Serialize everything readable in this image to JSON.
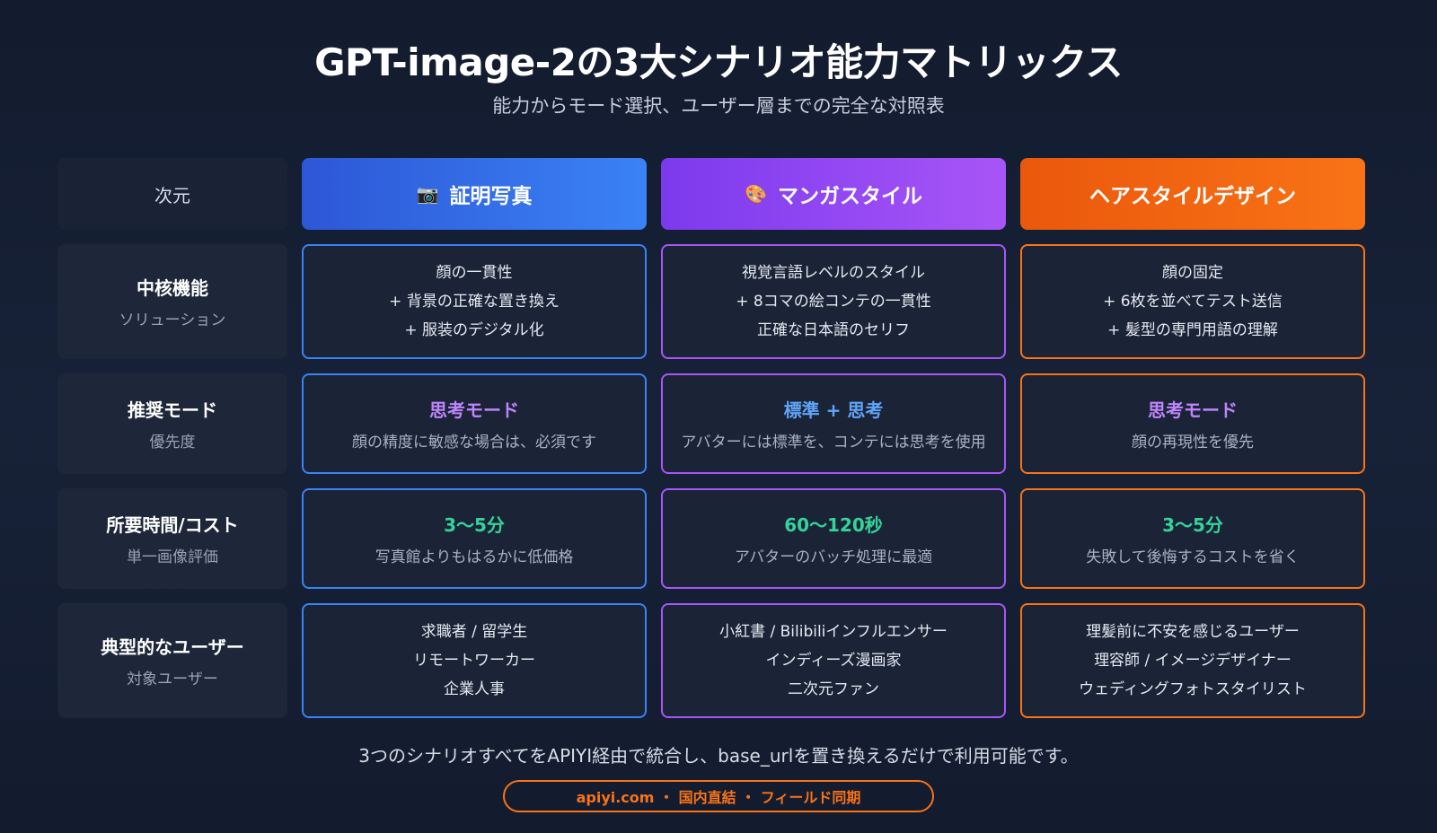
{
  "title": "GPT-image-2の3大シナリオ能力マトリックス",
  "subtitle": "能力からモード選択、ユーザー層までの完全な対照表",
  "matrix": {
    "dimension_header": "次元",
    "columns": [
      {
        "icon": "📷",
        "icon_name": "camera-icon",
        "label": "証明写真",
        "color": "#3b82f6"
      },
      {
        "icon": "🎨",
        "icon_name": "palette-icon",
        "label": "マンガスタイル",
        "color": "#a855f7"
      },
      {
        "icon": "",
        "icon_name": "",
        "label": "ヘアスタイルデザイン",
        "color": "#f97316"
      }
    ],
    "rows": [
      {
        "label": "中核機能",
        "sublabel": "ソリューション",
        "cells": [
          {
            "lines": [
              "顔の一貫性",
              "+ 背景の正確な置き換え",
              "+ 服装のデジタル化"
            ]
          },
          {
            "lines": [
              "視覚言語レベルのスタイル",
              "+ 8コマの絵コンテの一貫性",
              "正確な日本語のセリフ"
            ]
          },
          {
            "lines": [
              "顔の固定",
              "+ 6枚を並べてテスト送信",
              "+ 髪型の専門用語の理解"
            ]
          }
        ]
      },
      {
        "label": "推奨モード",
        "sublabel": "優先度",
        "cells": [
          {
            "accent": "思考モード",
            "accent_color": "#c084fc",
            "desc": "顔の精度に敏感な場合は、必須です"
          },
          {
            "accent": "標準 + 思考",
            "accent_color": "#60a5fa",
            "desc": "アバターには標準を、コンテには思考を使用"
          },
          {
            "accent": "思考モード",
            "accent_color": "#c084fc",
            "desc": "顔の再現性を優先"
          }
        ]
      },
      {
        "label": "所要時間/コスト",
        "sublabel": "単一画像評価",
        "cells": [
          {
            "accent": "3〜5分",
            "accent_color": "#34d399",
            "desc": "写真館よりもはるかに低価格"
          },
          {
            "accent": "60〜120秒",
            "accent_color": "#34d399",
            "desc": "アバターのバッチ処理に最適"
          },
          {
            "accent": "3〜5分",
            "accent_color": "#34d399",
            "desc": "失敗して後悔するコストを省く"
          }
        ]
      },
      {
        "label": "典型的なユーザー",
        "sublabel": "対象ユーザー",
        "cells": [
          {
            "lines": [
              "求職者 / 留学生",
              "リモートワーカー",
              "企業人事"
            ]
          },
          {
            "lines": [
              "小紅書 / Bilibiliインフルエンサー",
              "インディーズ漫画家",
              "二次元ファン"
            ]
          },
          {
            "lines": [
              "理髪前に不安を感じるユーザー",
              "理容師 / イメージデザイナー",
              "ウェディングフォトスタイリスト"
            ]
          }
        ]
      }
    ]
  },
  "footer": {
    "text": "3つのシナリオすべてをAPIYI経由で統合し、base_urlを置き換えるだけで利用可能です。",
    "badge": "apiyi.com ・ 国内直結 ・ フィールド同期"
  }
}
